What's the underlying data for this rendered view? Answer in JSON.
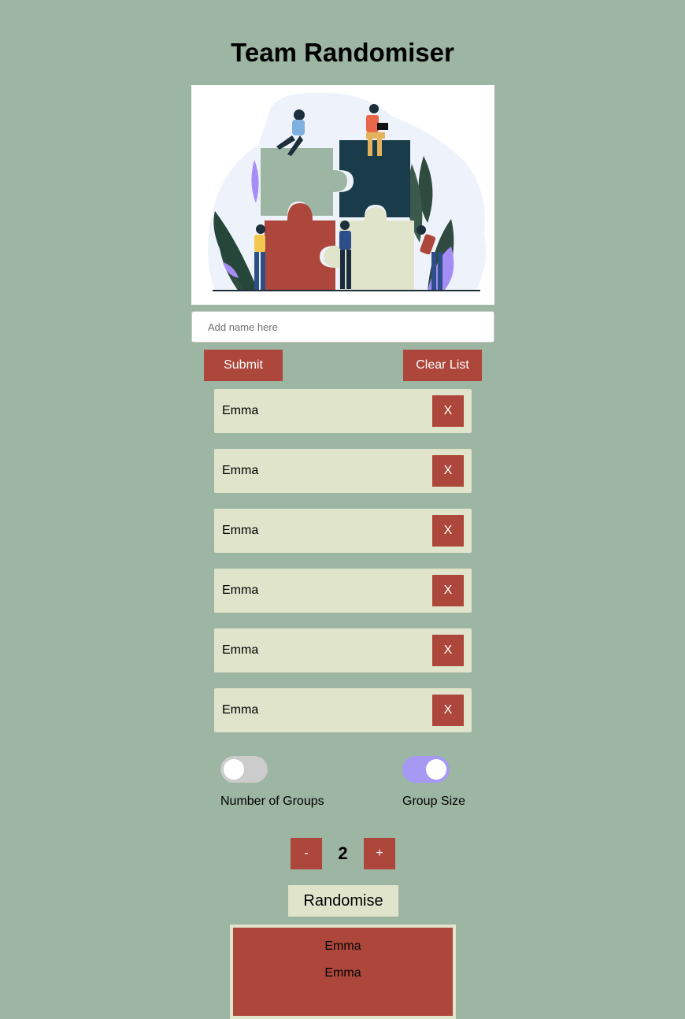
{
  "page": {
    "title": "Team Randomiser"
  },
  "hero": {
    "icon": "team-puzzle-illustration"
  },
  "name_input": {
    "placeholder": "Add name here",
    "value": ""
  },
  "actions": {
    "submit_label": "Submit",
    "clear_label": "Clear List"
  },
  "names": [
    {
      "name": "Emma",
      "remove_label": "X"
    },
    {
      "name": "Emma",
      "remove_label": "X"
    },
    {
      "name": "Emma",
      "remove_label": "X"
    },
    {
      "name": "Emma",
      "remove_label": "X"
    },
    {
      "name": "Emma",
      "remove_label": "X"
    },
    {
      "name": "Emma",
      "remove_label": "X"
    }
  ],
  "mode": {
    "groups_label": "Number of Groups",
    "groups_on": false,
    "size_label": "Group Size",
    "size_on": true
  },
  "counter": {
    "minus_label": "-",
    "value": "2",
    "plus_label": "+"
  },
  "randomise_label": "Randomise",
  "groups": [
    {
      "members": [
        "Emma",
        "Emma"
      ]
    }
  ],
  "colors": {
    "background": "#9db5a3",
    "accent_red": "#ad463b",
    "card_beige": "#e0e4ca",
    "toggle_on": "#a599f4",
    "toggle_off": "#cccccc"
  }
}
